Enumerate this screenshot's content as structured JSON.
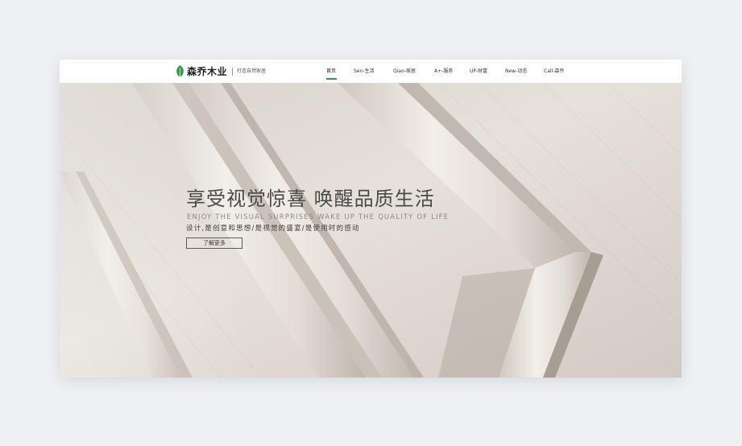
{
  "brand": {
    "name": "森乔木业",
    "slogan": "打造自然家居",
    "accent_color": "#2e9b47",
    "logo_icon": "leaf-icon"
  },
  "nav": {
    "items": [
      {
        "label": "首页",
        "active": true
      },
      {
        "label": "Sen-生活",
        "active": false
      },
      {
        "label": "Qiao-家居",
        "active": false
      },
      {
        "label": "A+-服务",
        "active": false
      },
      {
        "label": "UP-财富",
        "active": false
      },
      {
        "label": "New-动态",
        "active": false
      },
      {
        "label": "Call-森乔",
        "active": false
      }
    ]
  },
  "hero": {
    "title": "享受视觉惊喜 唤醒品质生活",
    "subtitle_en": "ENJOY THE VISUAL SURPRISES WAKE UP THE QUALITY OF LIFE",
    "description": "设计,是创意和思想/是视觉的盛宴/是使用时的感动",
    "button_label": "了解更多"
  }
}
